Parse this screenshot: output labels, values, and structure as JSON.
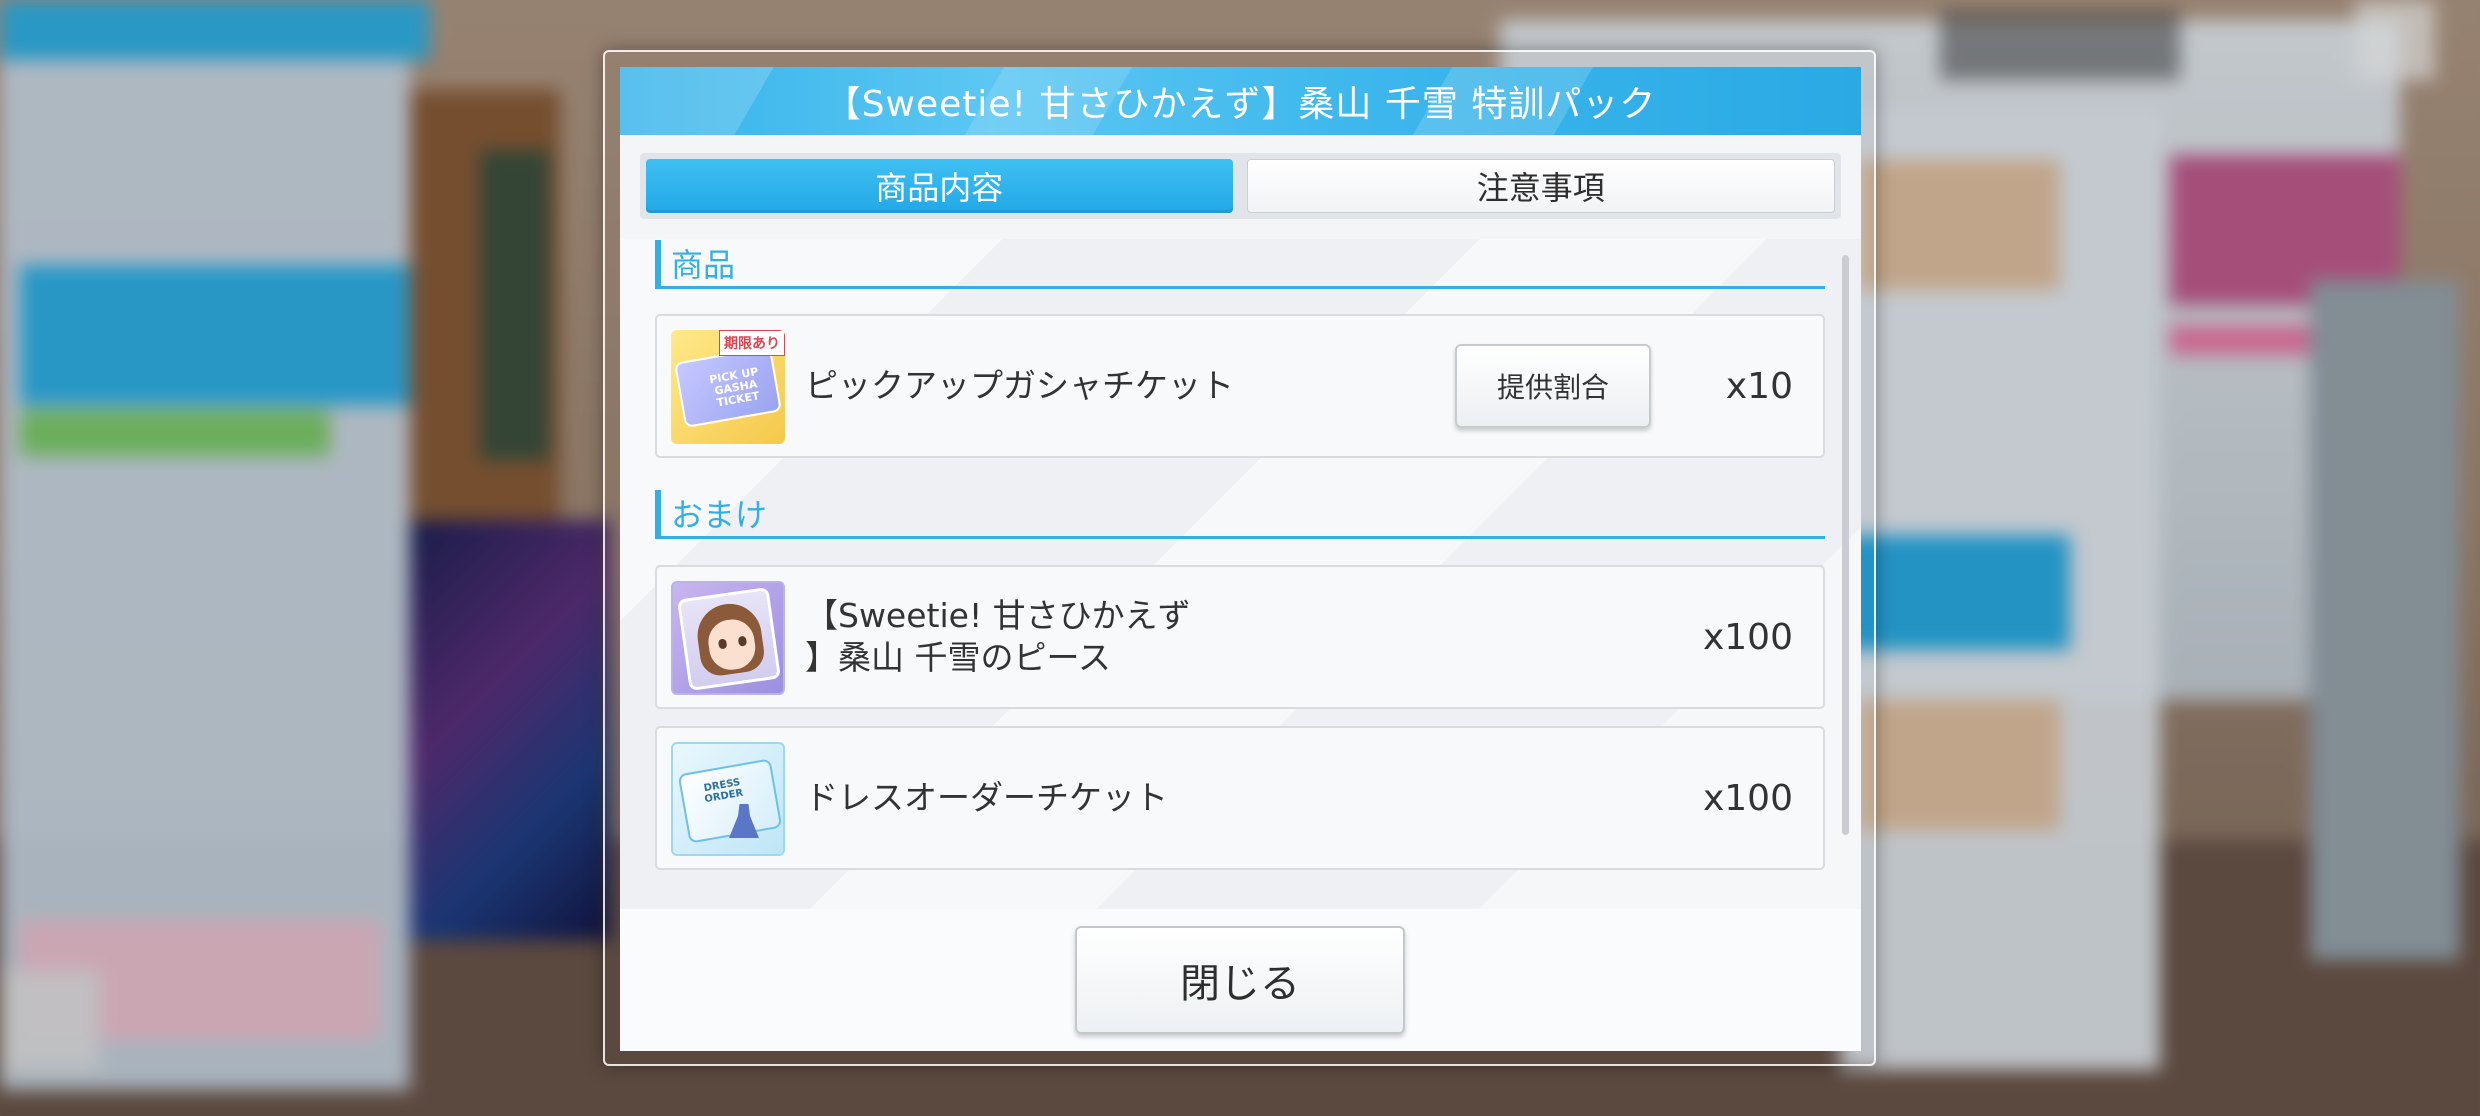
{
  "dialog": {
    "title": "【Sweetie! 甘さひかえず】桑山 千雪 特訓パック",
    "tabs": [
      {
        "label": "商品内容",
        "active": true
      },
      {
        "label": "注意事項",
        "active": false
      }
    ],
    "sections": {
      "products": {
        "heading": "商品",
        "items": [
          {
            "name": "ピックアップガシャチケット",
            "quantity": "x10",
            "rate_button_label": "提供割合",
            "icon": "gacha-ticket-icon",
            "badge": "期限あり",
            "ticket_text": "PICK UP GASHA TICKET"
          }
        ]
      },
      "bonus": {
        "heading": "おまけ",
        "items": [
          {
            "name_line1": "【Sweetie! 甘さひかえず",
            "name_line2": "】桑山 千雪のピース",
            "quantity": "x100",
            "icon": "idol-piece-icon"
          },
          {
            "name": "ドレスオーダーチケット",
            "quantity": "x100",
            "icon": "dress-order-ticket-icon",
            "ticket_text": "DRESS ORDER"
          }
        ]
      }
    },
    "close_label": "閉じる"
  },
  "colors": {
    "accent": "#32afe6",
    "tab_active": "#22a8e6",
    "title_bar": "#3db7ec",
    "badge_red": "#e2444f"
  }
}
